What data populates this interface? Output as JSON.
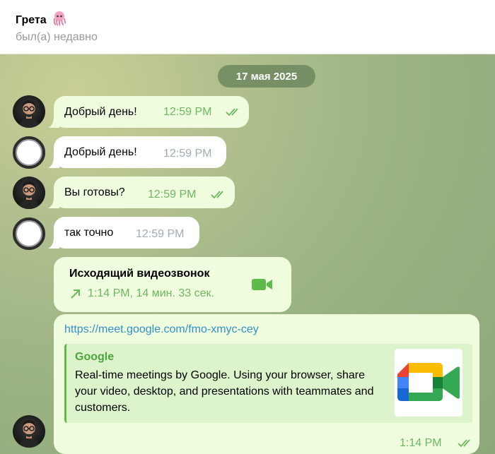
{
  "header": {
    "contact_name": "Грета",
    "status": "был(а) недавно"
  },
  "chat": {
    "date": "17 мая 2025",
    "messages": [
      {
        "direction": "out",
        "text": "Добрый день!",
        "time": "12:59 PM",
        "read": true
      },
      {
        "direction": "in",
        "text": "Добрый день!",
        "time": "12:59 PM"
      },
      {
        "direction": "out",
        "text": "Вы готовы?",
        "time": "12:59 PM",
        "read": true
      },
      {
        "direction": "in",
        "text": "так точно",
        "time": "12:59 PM"
      }
    ],
    "call": {
      "title": "Исходящий видеозвонок",
      "details": "1:14 PM, 14 мин. 33 сек.",
      "icon": "video-camera-icon"
    },
    "link_message": {
      "url": "https://meet.google.com/fmo-xmyc-cey",
      "preview_site": "Google",
      "preview_description": "Real-time meetings by Google. Using your browser, share your video, desktop, and presentations with teammates and customers.",
      "preview_image": "google-meet-logo",
      "time": "1:14 PM",
      "read": true
    }
  },
  "colors": {
    "outgoing_bubble": "#effdde",
    "incoming_bubble": "#ffffff",
    "accent_green": "#6cb85e",
    "link_blue": "#3390c8"
  }
}
